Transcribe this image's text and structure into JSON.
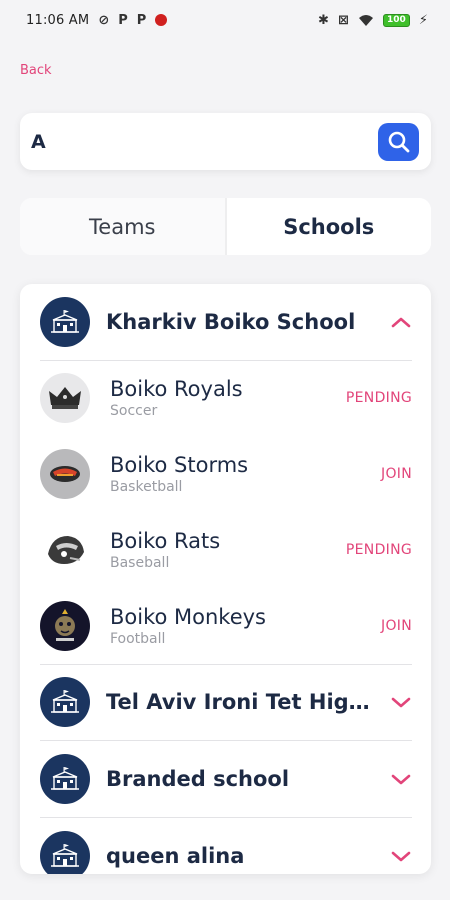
{
  "status_bar": {
    "time": "11:06 AM",
    "icons_left": [
      "alarm-off-icon",
      "p-app-icon",
      "p-app-icon",
      "tomato-icon"
    ],
    "icons_right": [
      "bluetooth-icon",
      "sim-off-icon",
      "wifi-icon",
      "battery-icon",
      "charging-icon"
    ],
    "battery_text": "100"
  },
  "nav": {
    "back_label": "Back"
  },
  "search": {
    "value": "A",
    "placeholder": "",
    "button_icon": "search-icon"
  },
  "tabs": [
    {
      "label": "Teams",
      "active": false
    },
    {
      "label": "Schools",
      "active": true
    }
  ],
  "colors": {
    "accent_pink": "#e2457a",
    "navy": "#1d2a44",
    "search_button": "#2f63e8",
    "school_logo_bg": "#1b3560"
  },
  "schools": [
    {
      "name": "Kharkiv Boiko School",
      "expanded": true,
      "teams": [
        {
          "name": "Boiko Royals",
          "sport": "Soccer",
          "status": "PENDING"
        },
        {
          "name": "Boiko Storms",
          "sport": "Basketball",
          "status": "JOIN"
        },
        {
          "name": "Boiko Rats",
          "sport": "Baseball",
          "status": "PENDING"
        },
        {
          "name": "Boiko Monkeys",
          "sport": "Football",
          "status": "JOIN"
        }
      ]
    },
    {
      "name": "Tel Aviv Ironi Tet High School",
      "expanded": false,
      "teams": []
    },
    {
      "name": "Branded school",
      "expanded": false,
      "teams": []
    },
    {
      "name": "queen alina",
      "expanded": false,
      "teams": []
    }
  ]
}
